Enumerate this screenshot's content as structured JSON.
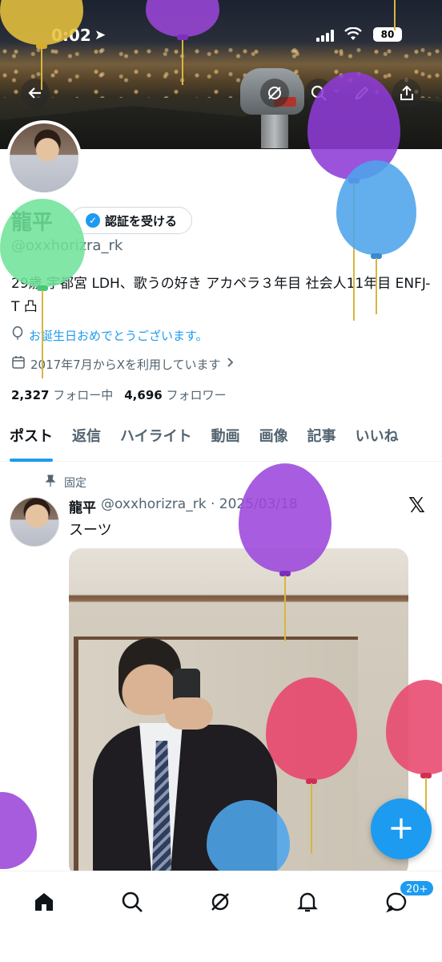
{
  "status_bar": {
    "time": "0:02",
    "battery": "80"
  },
  "profile": {
    "name": "龍平",
    "verify_button": "認証を受ける",
    "handle": "@oxxhorizra_rk",
    "bio": "29歳 宇都宮 LDH、歌うの好き アカペラ３年目 社会人11年目 ENFJ-T 凸",
    "birthday_text": "お誕生日おめでとうございます。",
    "joined_text": "2017年7月からXを利用しています",
    "following_count": "2,327",
    "following_label": "フォロー中",
    "followers_count": "4,696",
    "followers_label": "フォロワー"
  },
  "tabs": [
    "ポスト",
    "返信",
    "ハイライト",
    "動画",
    "画像",
    "記事",
    "いいね"
  ],
  "post": {
    "pinned_label": "固定",
    "name": "龍平",
    "handle_date": "@oxxhorizra_rk · 2025/03/18",
    "text": "スーツ"
  },
  "bottom_nav": {
    "notification_badge": "20+"
  },
  "icons": [
    "back-arrow-icon",
    "grok-icon",
    "search-icon",
    "edit-icon",
    "share-icon",
    "balloon-icon",
    "calendar-icon",
    "pin-icon",
    "x-logo-icon",
    "compose-plus-icon",
    "home-icon",
    "explore-icon",
    "notifications-bell-icon",
    "messages-icon"
  ],
  "colors": {
    "accent": "#1d9bf0",
    "text": "#0f1419",
    "secondary": "#536471"
  }
}
